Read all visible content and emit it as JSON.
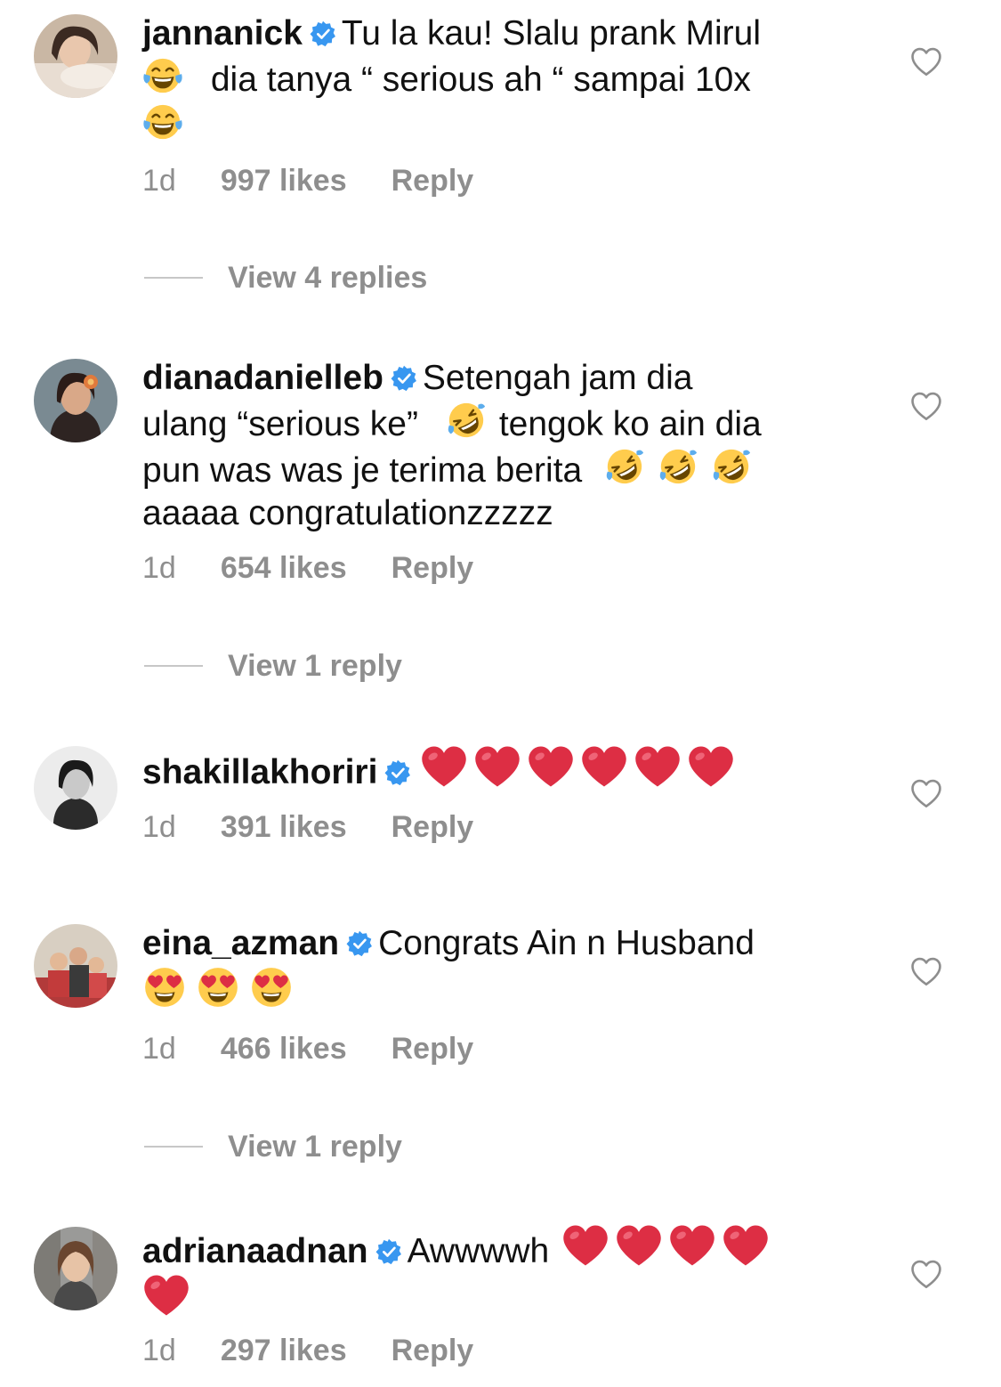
{
  "comments": [
    {
      "username": "jannanick",
      "text_1": "Tu la kau! Slalu prank Mirul",
      "text_2": "dia tanya “ serious ah “ sampai 10x",
      "time": "1d",
      "likes": "997 likes",
      "reply": "Reply",
      "view_replies": "View 4 replies"
    },
    {
      "username": "dianadanielleb",
      "text_1": "Setengah jam dia",
      "text_2": "ulang “serious ke”",
      "text_3": "tengok ko ain dia",
      "text_4": "pun was was je terima berita",
      "text_5": "aaaaa congratulationzzzzz",
      "time": "1d",
      "likes": "654 likes",
      "reply": "Reply",
      "view_replies": "View 1 reply"
    },
    {
      "username": "shakillakhoriri",
      "time": "1d",
      "likes": "391 likes",
      "reply": "Reply"
    },
    {
      "username": "eina_azman",
      "text_1": "Congrats Ain n Husband",
      "time": "1d",
      "likes": "466 likes",
      "reply": "Reply",
      "view_replies": "View 1 reply"
    },
    {
      "username": "adrianaadnan",
      "text_1": "Awwwwh",
      "time": "1d",
      "likes": "297 likes",
      "reply": "Reply"
    }
  ],
  "colors": {
    "verified_blue": "#3897f0",
    "meta_gray": "#8e8e8e",
    "heart_red": "#e0245e",
    "emoji_yellow": "#ffcc4d"
  },
  "icons": {
    "verified": "verified-badge-icon",
    "like": "heart-outline-icon",
    "tears_of_joy": "face-with-tears-of-joy-emoji",
    "rofl": "rolling-on-the-floor-laughing-emoji",
    "heart_eyes": "smiling-face-with-heart-eyes-emoji",
    "red_heart": "red-heart-emoji"
  }
}
